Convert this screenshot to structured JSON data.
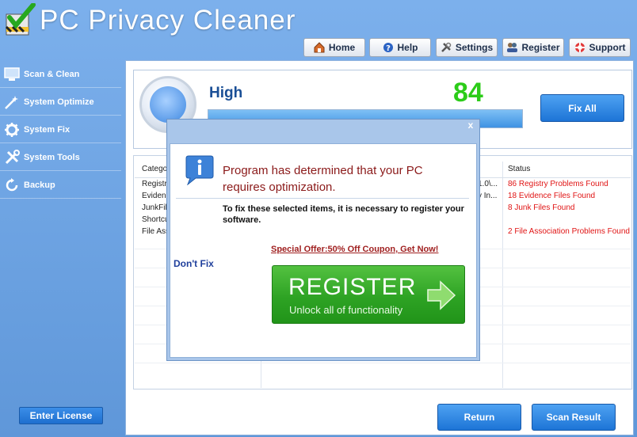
{
  "app": {
    "title": "PC Privacy Cleaner"
  },
  "nav": [
    {
      "label": "Home",
      "icon": "home-icon"
    },
    {
      "label": "Help",
      "icon": "help-icon"
    },
    {
      "label": "Settings",
      "icon": "settings-icon"
    },
    {
      "label": "Register",
      "icon": "register-icon"
    },
    {
      "label": "Support",
      "icon": "support-icon"
    }
  ],
  "sidebar": {
    "items": [
      {
        "label": "Scan & Clean",
        "icon": "monitor-icon"
      },
      {
        "label": "System Optimize",
        "icon": "wand-icon"
      },
      {
        "label": "System Fix",
        "icon": "gear-icon"
      },
      {
        "label": "System Tools",
        "icon": "tools-icon"
      },
      {
        "label": "Backup",
        "icon": "backup-icon"
      }
    ],
    "license_label": "Enter License"
  },
  "status": {
    "level": "High",
    "score": "84",
    "fix_all_label": "Fix All",
    "progress": 1.0
  },
  "table": {
    "headers": [
      "Catego",
      "Status"
    ],
    "rows": [
      {
        "category": "Registr",
        "detail": "1.0\\...",
        "status": "86 Registry Problems Found"
      },
      {
        "category": "Evidenc",
        "detail": "y In...",
        "status": "18 Evidence Files Found"
      },
      {
        "category": "JunkFile",
        "detail": "",
        "status": "8 Junk Files Found"
      },
      {
        "category": "Shortcu",
        "detail": "",
        "status": ""
      },
      {
        "category": "File Ass",
        "detail": "",
        "status": "2 File Association Problems Found"
      }
    ]
  },
  "buttons": {
    "return_label": "Return",
    "scan_result_label": "Scan Result"
  },
  "dialog": {
    "close": "x",
    "heading": "Program has determined that your PC requires optimization.",
    "message": "To fix these selected items, it is necessary to register your software.",
    "dont_fix": "Don't Fix",
    "offer": "Special Offer:50% Off Coupon, Get Now!",
    "register_title": "REGISTER",
    "register_sub": "Unlock all of functionality"
  },
  "colors": {
    "accent": "#1d74d6",
    "score": "#2ccc19",
    "alert": "#e01414",
    "register": "#2ea324"
  }
}
